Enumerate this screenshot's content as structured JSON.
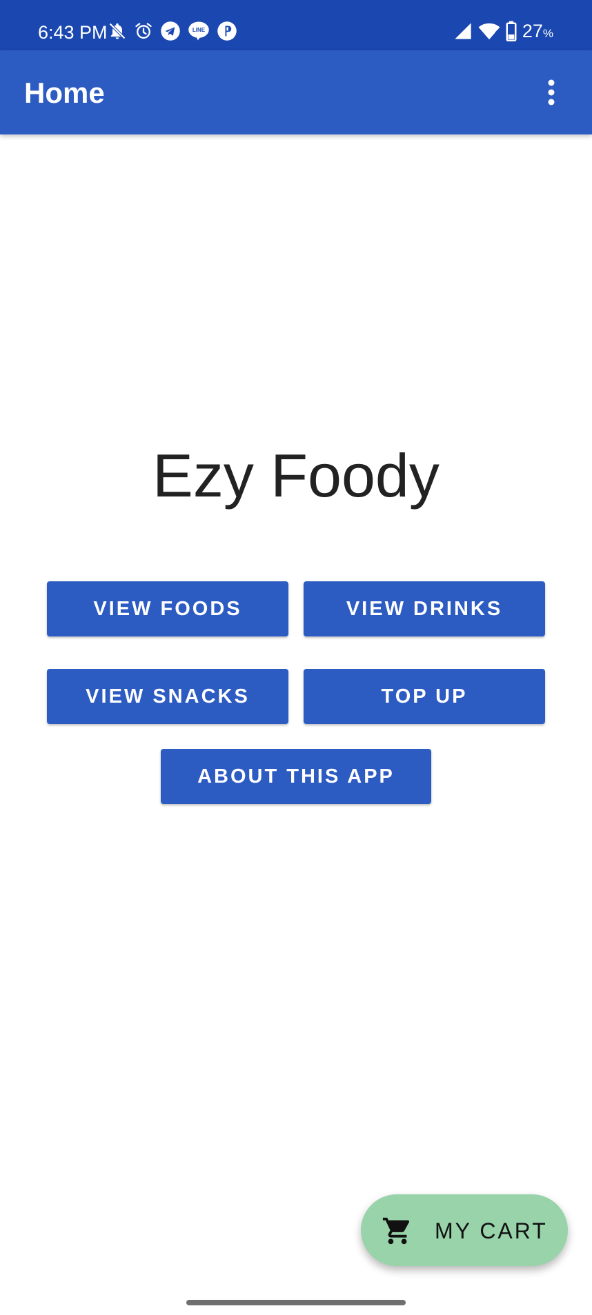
{
  "status_bar": {
    "time": "6:43 PM",
    "battery_percent": "27",
    "battery_unit": "%",
    "icons_left": [
      "bell-off-icon",
      "alarm-icon",
      "telegram-icon",
      "line-icon",
      "pinterest-icon"
    ],
    "icons_right": [
      "signal-icon",
      "wifi-icon",
      "battery-icon"
    ],
    "background": "#1a47b0"
  },
  "app_bar": {
    "title": "Home",
    "overflow_icon": "more-vert-icon",
    "background": "#2c5bc2"
  },
  "main": {
    "brand_title": "Ezy Foody",
    "buttons": {
      "view_foods": "VIEW FOODS",
      "view_drinks": "VIEW DRINKS",
      "view_snacks": "VIEW SNACKS",
      "top_up": "TOP UP",
      "about": "ABOUT THIS APP"
    },
    "button_color": "#2c5bc2"
  },
  "fab": {
    "label": "MY CART",
    "icon": "cart-icon",
    "background": "#98d3aa"
  }
}
